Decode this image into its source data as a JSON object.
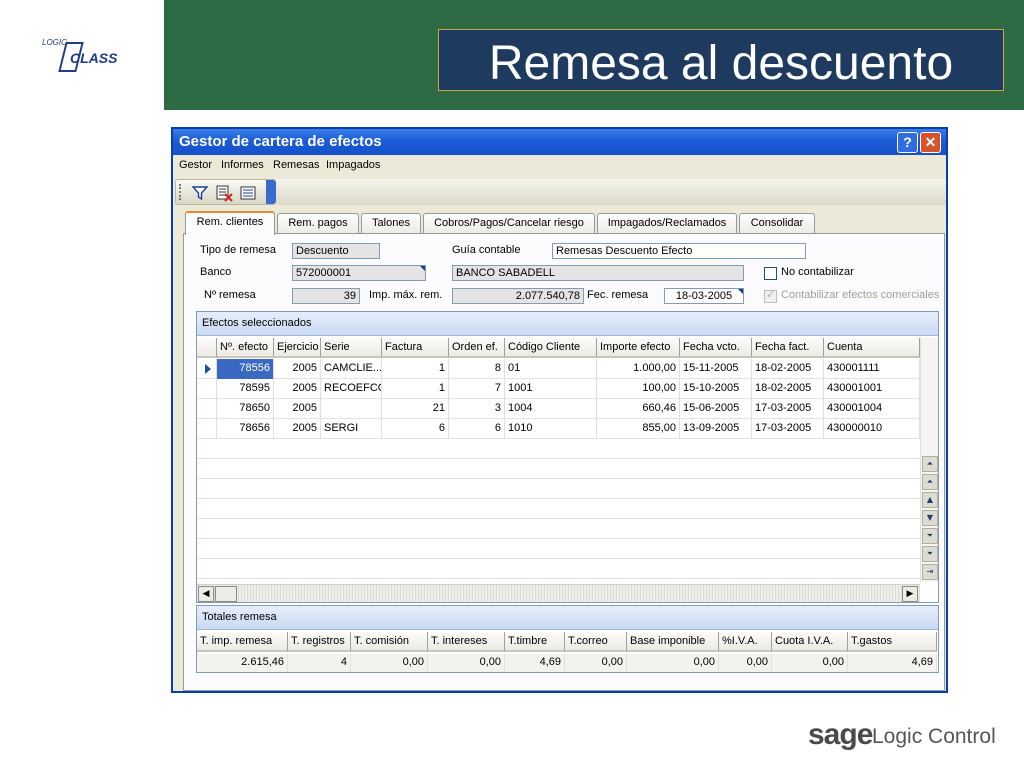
{
  "slide": {
    "title": "Remesa al descuento",
    "logo_small": "LOGIC",
    "logo_main": "CLASS",
    "brand_sage": "sage",
    "brand_product": "Logic Control"
  },
  "window": {
    "title": "Gestor de cartera de efectos",
    "help_label": "?",
    "close_label": "✕",
    "menu": [
      "Gestor",
      "Informes",
      "Remesas",
      "Impagados"
    ]
  },
  "toolbar": {
    "icons": [
      "filter-icon",
      "delete-icon",
      "list-icon"
    ]
  },
  "tabs": [
    {
      "label": "Rem. clientes",
      "active": true
    },
    {
      "label": "Rem. pagos",
      "active": false
    },
    {
      "label": "Talones",
      "active": false
    },
    {
      "label": "Cobros/Pagos/Cancelar riesgo",
      "active": false
    },
    {
      "label": "Impagados/Reclamados",
      "active": false
    },
    {
      "label": "Consolidar",
      "active": false
    }
  ],
  "form": {
    "tipo_remesa_label": "Tipo de remesa",
    "tipo_remesa_value": "Descuento",
    "guia_contable_label": "Guía contable",
    "guia_contable_value": "Remesas Descuento Efecto",
    "banco_label": "Banco",
    "banco_code": "572000001",
    "banco_name": "BANCO SABADELL",
    "no_contabilizar_label": "No contabilizar",
    "num_remesa_label": "Nº remesa",
    "num_remesa_value": "39",
    "imp_max_label": "Imp. máx. rem.",
    "imp_max_value": "2.077.540,78",
    "fec_remesa_label": "Fec. remesa",
    "fec_remesa_value": "18-03-2005",
    "contabilizar_label": "Contabilizar efectos comerciales"
  },
  "efectos": {
    "caption": "Efectos seleccionados",
    "columns": [
      "Nº. efecto",
      "Ejercicio",
      "Serie",
      "Factura",
      "Orden ef.",
      "Código Cliente",
      "Importe efecto",
      "Fecha vcto.",
      "Fecha fact.",
      "Cuenta"
    ],
    "rows": [
      [
        "78556",
        "2005",
        "CAMCLIE...",
        "1",
        "8",
        "01",
        "1.000,00",
        "15-11-2005",
        "18-02-2005",
        "430001111"
      ],
      [
        "78595",
        "2005",
        "RECOEFCO",
        "1",
        "7",
        "1001",
        "100,00",
        "15-10-2005",
        "18-02-2005",
        "430001001"
      ],
      [
        "78650",
        "2005",
        "",
        "21",
        "3",
        "1004",
        "660,46",
        "15-06-2005",
        "17-03-2005",
        "430001004"
      ],
      [
        "78656",
        "2005",
        "SERGI",
        "6",
        "6",
        "1010",
        "855,00",
        "13-09-2005",
        "17-03-2005",
        "430000010"
      ]
    ]
  },
  "totales": {
    "caption": "Totales remesa",
    "columns": [
      "T. imp. remesa",
      "T. registros",
      "T. comisión",
      "T. intereses",
      "T.timbre",
      "T.correo",
      "Base imponible",
      "%I.V.A.",
      "Cuota I.V.A.",
      "T.gastos"
    ],
    "values": [
      "2.615,46",
      "4",
      "0,00",
      "0,00",
      "4,69",
      "0,00",
      "0,00",
      "0,00",
      "0,00",
      "4,69"
    ]
  }
}
